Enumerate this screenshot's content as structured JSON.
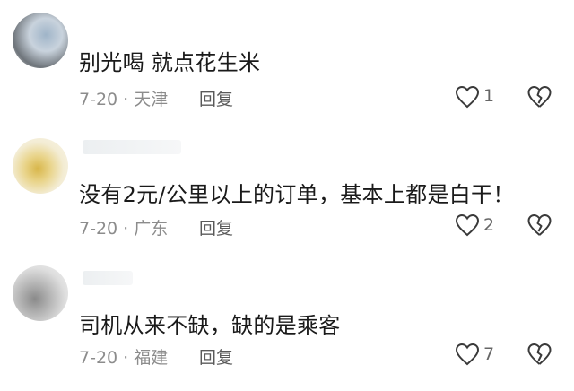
{
  "comments": [
    {
      "text": "别光喝 就点花生米",
      "date": "7-20",
      "location": "天津",
      "reply_label": "回复",
      "likes": "1"
    },
    {
      "text": "没有2元/公里以上的订单，基本上都是白干！",
      "date": "7-20",
      "location": "广东",
      "reply_label": "回复",
      "likes": "2"
    },
    {
      "text": "司机从来不缺，缺的是乘客",
      "date": "7-20",
      "location": "福建",
      "reply_label": "回复",
      "likes": "7"
    }
  ],
  "separator": " · ",
  "icons": {
    "like": "heart-outline-icon",
    "dislike": "broken-heart-icon"
  },
  "colors": {
    "text": "#1a1a1a",
    "meta": "#8c8c8c",
    "icon": "#3a3a3a"
  }
}
